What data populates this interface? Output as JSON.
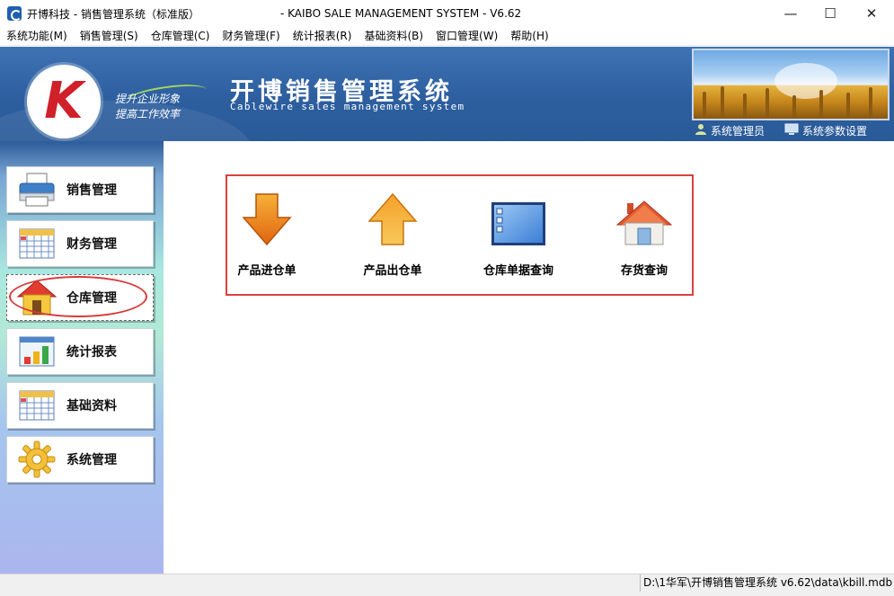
{
  "window": {
    "title": "开博科技 - 销售管理系统（标准版）",
    "title_right": "- KAIBO SALE MANAGEMENT SYSTEM - V6.62",
    "min_glyph": "—",
    "max_glyph": "☐",
    "close_glyph": "✕"
  },
  "menu": [
    "系统功能(M)",
    "销售管理(S)",
    "仓库管理(C)",
    "财务管理(F)",
    "统计报表(R)",
    "基础资料(B)",
    "窗口管理(W)",
    "帮助(H)"
  ],
  "banner": {
    "logo_letter": "K",
    "slogan_line1": "提升企业形象",
    "slogan_line2": "提高工作效率",
    "title": "开博销售管理系统",
    "subtitle": "Cablewire sales management system",
    "user_link": "系统管理员",
    "settings_link": "系统参数设置"
  },
  "sidebar": {
    "items": [
      {
        "label": "销售管理",
        "icon": "printer-icon"
      },
      {
        "label": "财务管理",
        "icon": "calendar-icon"
      },
      {
        "label": "仓库管理",
        "icon": "house-icon"
      },
      {
        "label": "统计报表",
        "icon": "bar-chart-icon"
      },
      {
        "label": "基础资料",
        "icon": "calendar-icon"
      },
      {
        "label": "系统管理",
        "icon": "gear-icon"
      }
    ],
    "active_index": 2
  },
  "content": {
    "tiles": [
      {
        "label": "产品进仓单",
        "icon": "arrow-down-icon"
      },
      {
        "label": "产品出仓单",
        "icon": "arrow-up-icon"
      },
      {
        "label": "仓库单据查询",
        "icon": "document-list-icon"
      },
      {
        "label": "存货查询",
        "icon": "house-icon"
      }
    ]
  },
  "status": {
    "path": "D:\\1华军\\开博销售管理系统 v6.62\\data\\kbill.mdb"
  },
  "colors": {
    "banner_blue": "#2d5f9f",
    "highlight_red": "#d8423f",
    "arrow_orange": "#f39a1c"
  }
}
